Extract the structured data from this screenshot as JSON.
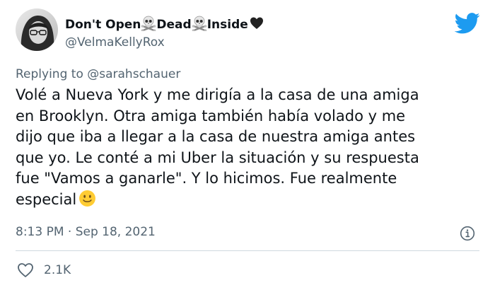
{
  "tweet": {
    "display_name_part1": "Don't Open ",
    "display_name_part2": "Dead",
    "display_name_part3": " Inside",
    "handle": "@VelmaKellyRox",
    "replying_prefix": "Replying to ",
    "replying_to": "@sarahschauer",
    "body_lines": [
      "Volé a Nueva York y me dirigía a la casa de una amiga",
      "en Brooklyn. Otra amiga también había volado y me",
      "dijo que iba a llegar a la casa de nuestra amiga antes",
      "que yo. Le conté a mi Uber la situación y su respuesta",
      "fue \"Vamos a ganarle\". Y lo hicimos. Fue realmente",
      "especial"
    ],
    "timestamp": "8:13 PM · Sep 18, 2021",
    "like_count": "2.1K"
  },
  "icons": {
    "name_emoji_1": "skull-crossbones-icon",
    "name_emoji_2": "skull-crossbones-icon",
    "name_emoji_3": "black-heart-icon",
    "body_emoji": "slightly-smiling-face-icon",
    "brand": "twitter-bird-icon",
    "info": "info-icon",
    "like": "heart-outline-icon"
  },
  "colors": {
    "brand_blue": "#1d9bf0",
    "secondary_text": "#536471",
    "primary_text": "#0f1419",
    "divider": "#cfd9de",
    "emoji_yellow": "#ffcc33"
  }
}
